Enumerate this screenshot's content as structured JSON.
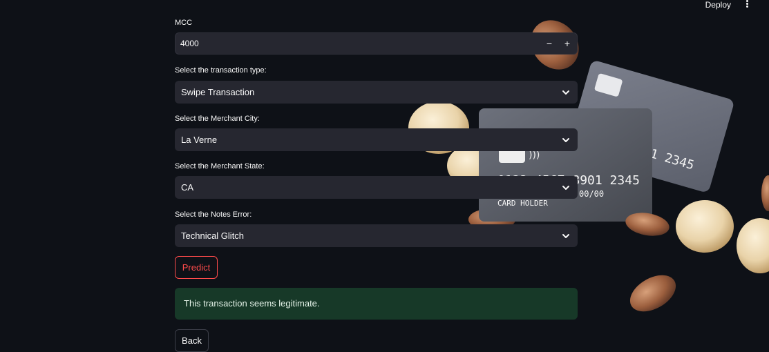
{
  "header": {
    "deploy_label": "Deploy",
    "menu_icon": "kebab-menu-icon"
  },
  "form": {
    "mcc": {
      "label": "MCC",
      "value": "4000",
      "decrement": "−",
      "increment": "+"
    },
    "transaction_type": {
      "label": "Select the transaction type:",
      "value": "Swipe Transaction"
    },
    "merchant_city": {
      "label": "Select the Merchant City:",
      "value": "La Verne"
    },
    "merchant_state": {
      "label": "Select the Merchant State:",
      "value": "CA"
    },
    "notes_error": {
      "label": "Select the Notes Error:",
      "value": "Technical Glitch"
    },
    "predict_label": "Predict",
    "result": "This transaction seems legitimate.",
    "back_label": "Back"
  },
  "background": {
    "front_card": {
      "number": "0123 4567 8901 2345",
      "expiry": "00/00",
      "holder": "CARD HOLDER"
    },
    "back_card": {
      "number": "01 2345"
    }
  },
  "colors": {
    "accent": "#ff4b4b",
    "success_bg": "#173928",
    "field_bg": "#262730",
    "app_bg": "#0e1117"
  }
}
